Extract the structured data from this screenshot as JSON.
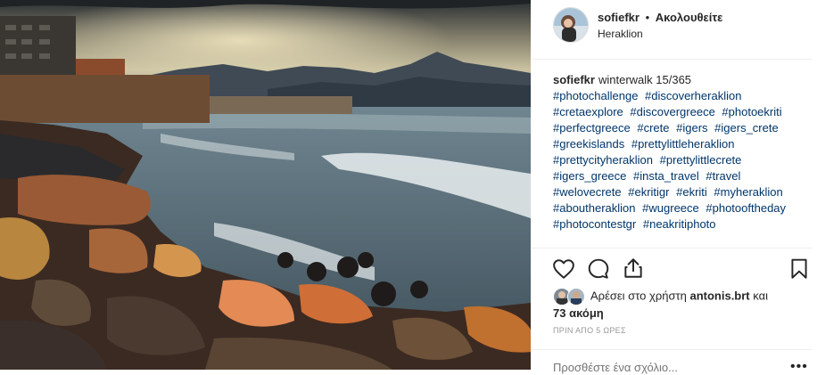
{
  "post": {
    "username": "sofiefkr",
    "separator": "•",
    "follow_label": "Ακολουθείτε",
    "location": "Heraklion"
  },
  "caption": {
    "username": "sofiefkr",
    "text": "winterwalk 15/365",
    "hashtags": [
      "#photochallenge",
      "#discoverheraklion",
      "#cretaexplore",
      "#discovergreece",
      "#photoekriti",
      "#perfectgreece",
      "#crete",
      "#igers",
      "#igers_crete",
      "#greekislands",
      "#prettylittleheraklion",
      "#prettycityheraklion",
      "#prettylittlecrete",
      "#igers_greece",
      "#insta_travel",
      "#travel",
      "#welovecrete",
      "#ekritigr",
      "#ekriti",
      "#myheraklion",
      "#aboutheraklion",
      "#wugreece",
      "#photooftheday",
      "#photocontestgr",
      "#neakritiphoto"
    ]
  },
  "actions": {
    "like_icon": "heart-icon",
    "comment_icon": "comment-bubble-icon",
    "share_icon": "share-icon",
    "save_icon": "bookmark-icon"
  },
  "likes": {
    "prefix": "Αρέσει στο χρήστη",
    "user": "antonis.brt",
    "conjunction": "και",
    "others": "73 ακόμη"
  },
  "timestamp": "ΠΡΙΝ ΑΠΟ 5 ΩΡΕΣ",
  "comment": {
    "placeholder": "Προσθέστε ένα σχόλιο...",
    "more_icon": "more-options-icon"
  },
  "colors": {
    "text": "#262626",
    "hashtag": "#003569",
    "muted": "#999999",
    "divider": "#efefef"
  }
}
